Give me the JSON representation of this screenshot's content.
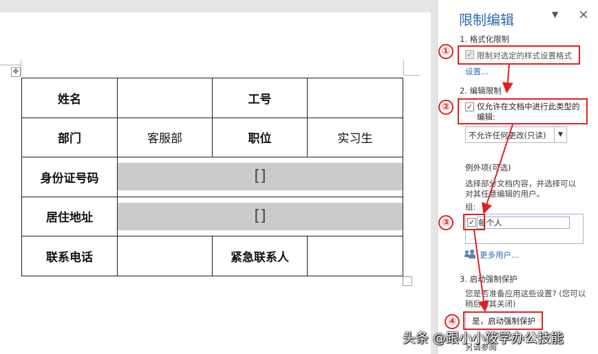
{
  "document": {
    "table": {
      "rows": [
        [
          "姓名",
          "",
          "工号",
          ""
        ],
        [
          "部门",
          "客服部",
          "职位",
          "实习生"
        ],
        [
          "身份证号码",
          "[]"
        ],
        [
          "居住地址",
          "[]"
        ],
        [
          "联系电话",
          "",
          "紧急联系人",
          ""
        ]
      ]
    }
  },
  "pane": {
    "title": "限制编辑",
    "menu_glyph": "▼",
    "close_glyph": "×",
    "section1": {
      "heading": "1. 格式化限制",
      "checkbox_label": "限制对选定的样式设置格式",
      "checked": true,
      "settings_link": "设置..."
    },
    "section2": {
      "heading": "2. 编辑限制",
      "checkbox_label_line1": "仅允许在文档中进行此类型的",
      "checkbox_label_line2": "编辑:",
      "checked": true,
      "dropdown_value": "不允许任何更改(只读)",
      "exceptions_heading": "例外项(可选)",
      "exceptions_desc_line1": "选择部分文档内容，并选择可以",
      "exceptions_desc_line2": "对其任意编辑的用户。",
      "groups_label": "组:",
      "group_item": "每个人",
      "group_checked": true,
      "more_users_link": "更多用户..."
    },
    "section3": {
      "heading": "3. 启动强制保护",
      "question_line1": "您是否准备应用这些设置? (您可以",
      "question_line2": "稍后将其关闭)",
      "start_button": "是，启动强制保护",
      "next_partial": "另请参阅"
    }
  },
  "annotations": {
    "markers": [
      "①",
      "②",
      "③",
      "④"
    ],
    "color": "#e02020"
  },
  "watermark": "头条 @跟小小筱学办公技能"
}
